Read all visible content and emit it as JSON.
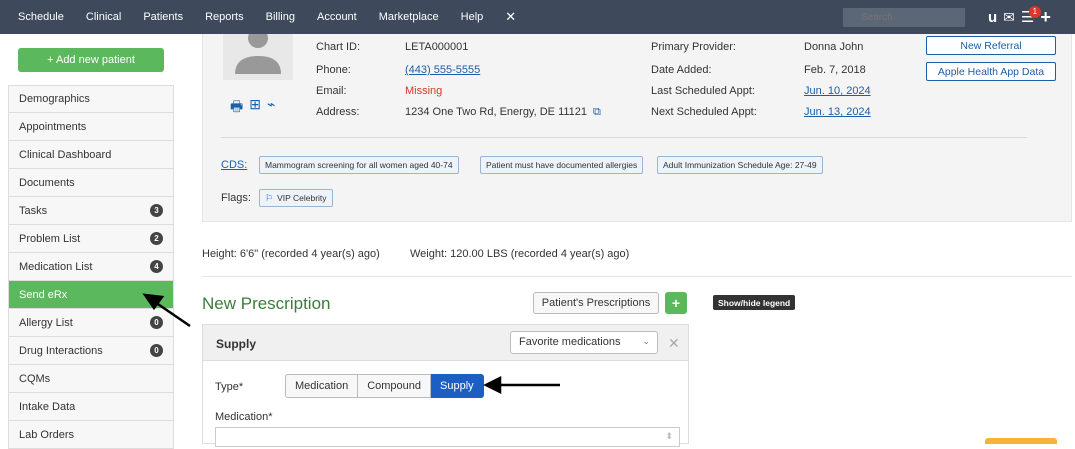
{
  "topnav": {
    "items": [
      "Schedule",
      "Clinical",
      "Patients",
      "Reports",
      "Billing",
      "Account",
      "Marketplace",
      "Help"
    ],
    "close_glyph": "✕",
    "search_placeholder": "Search",
    "icons": [
      "u-icon",
      "mail-icon",
      "menu-icon",
      "plus-icon"
    ],
    "notification_count": "1"
  },
  "sidebar": {
    "add_button_label": "+ Add new patient",
    "items": [
      {
        "label": "Demographics",
        "badge": ""
      },
      {
        "label": "Appointments",
        "badge": ""
      },
      {
        "label": "Clinical Dashboard",
        "badge": ""
      },
      {
        "label": "Documents",
        "badge": ""
      },
      {
        "label": "Tasks",
        "badge": "3"
      },
      {
        "label": "Problem List",
        "badge": "2"
      },
      {
        "label": "Medication List",
        "badge": "4"
      },
      {
        "label": "Send eRx",
        "badge": "",
        "active": true
      },
      {
        "label": "Allergy List",
        "badge": "0"
      },
      {
        "label": "Drug Interactions",
        "badge": "0"
      },
      {
        "label": "CQMs",
        "badge": ""
      },
      {
        "label": "Intake Data",
        "badge": ""
      },
      {
        "label": "Lab Orders",
        "badge": ""
      }
    ]
  },
  "patient": {
    "chart_id_label": "Chart ID:",
    "chart_id": "LETA000001",
    "phone_label": "Phone:",
    "phone": "(443) 555-5555",
    "email_label": "Email:",
    "email": "Missing",
    "address_label": "Address:",
    "address": "1234 One Two Rd, Energy, DE 11121",
    "primary_provider_label": "Primary Provider:",
    "primary_provider": "Donna John",
    "date_added_label": "Date Added:",
    "date_added": "Feb. 7, 2018",
    "last_appt_label": "Last Scheduled Appt:",
    "last_appt": "Jun. 10, 2024",
    "next_appt_label": "Next Scheduled Appt:",
    "next_appt": "Jun. 13, 2024",
    "new_referral_label": "New Referral",
    "apple_health_label": "Apple Health App Data",
    "cds_label": "CDS:",
    "cds_items": [
      "Mammogram screening for all women aged 40-74",
      "Patient must have documented allergies",
      "Adult Immunization Schedule Age: 27-49"
    ],
    "flags_label": "Flags:",
    "flag": "VIP Celebrity"
  },
  "vitals": {
    "height": "Height: 6'6\" (recorded 4 year(s) ago)",
    "weight": "Weight: 120.00 LBS (recorded 4 year(s) ago)"
  },
  "prescription": {
    "title": "New Prescription",
    "patients_prescriptions_label": "Patient's Prescriptions",
    "add_label": "+",
    "legend_label": "Show/hide legend",
    "card_title": "Supply",
    "favorite_select_value": "Favorite medications",
    "type_label": "Type*",
    "type_options": [
      "Medication",
      "Compound",
      "Supply"
    ],
    "type_selected": "Supply",
    "medication_label": "Medication*"
  },
  "colors": {
    "nav_bg": "#3e4a5c",
    "accent_green": "#5cb85c",
    "link_blue": "#1a5fa8",
    "selected_blue": "#1b5fc4",
    "missing_red": "#d9372b"
  }
}
